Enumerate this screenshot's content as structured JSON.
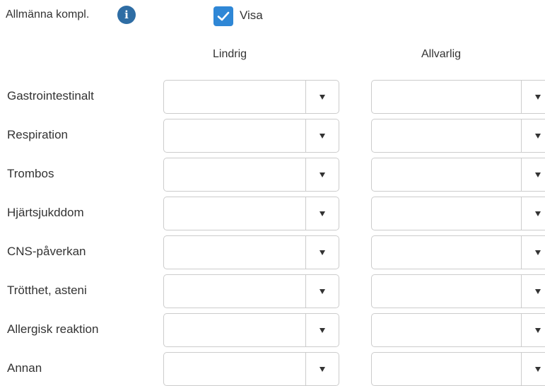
{
  "header": {
    "label": "Allmänna kompl.",
    "info_icon": "info-icon",
    "show_checkbox": {
      "label": "Visa",
      "checked": true,
      "color": "#2f87d6"
    }
  },
  "columns": {
    "mild": "Lindrig",
    "severe": "Allvarlig"
  },
  "rows": [
    {
      "label": "Gastrointestinalt",
      "mild_value": "",
      "severe_value": ""
    },
    {
      "label": "Respiration",
      "mild_value": "",
      "severe_value": ""
    },
    {
      "label": "Trombos",
      "mild_value": "",
      "severe_value": ""
    },
    {
      "label": "Hjärtsjukddom",
      "mild_value": "",
      "severe_value": ""
    },
    {
      "label": "CNS-påverkan",
      "mild_value": "",
      "severe_value": ""
    },
    {
      "label": "Trötthet, asteni",
      "mild_value": "",
      "severe_value": ""
    },
    {
      "label": "Allergisk reaktion",
      "mild_value": "",
      "severe_value": ""
    },
    {
      "label": "Annan",
      "mild_value": "",
      "severe_value": ""
    }
  ],
  "colors": {
    "accent": "#2f87d6",
    "info": "#2e6da4",
    "border": "#cccccc",
    "text": "#333333"
  }
}
